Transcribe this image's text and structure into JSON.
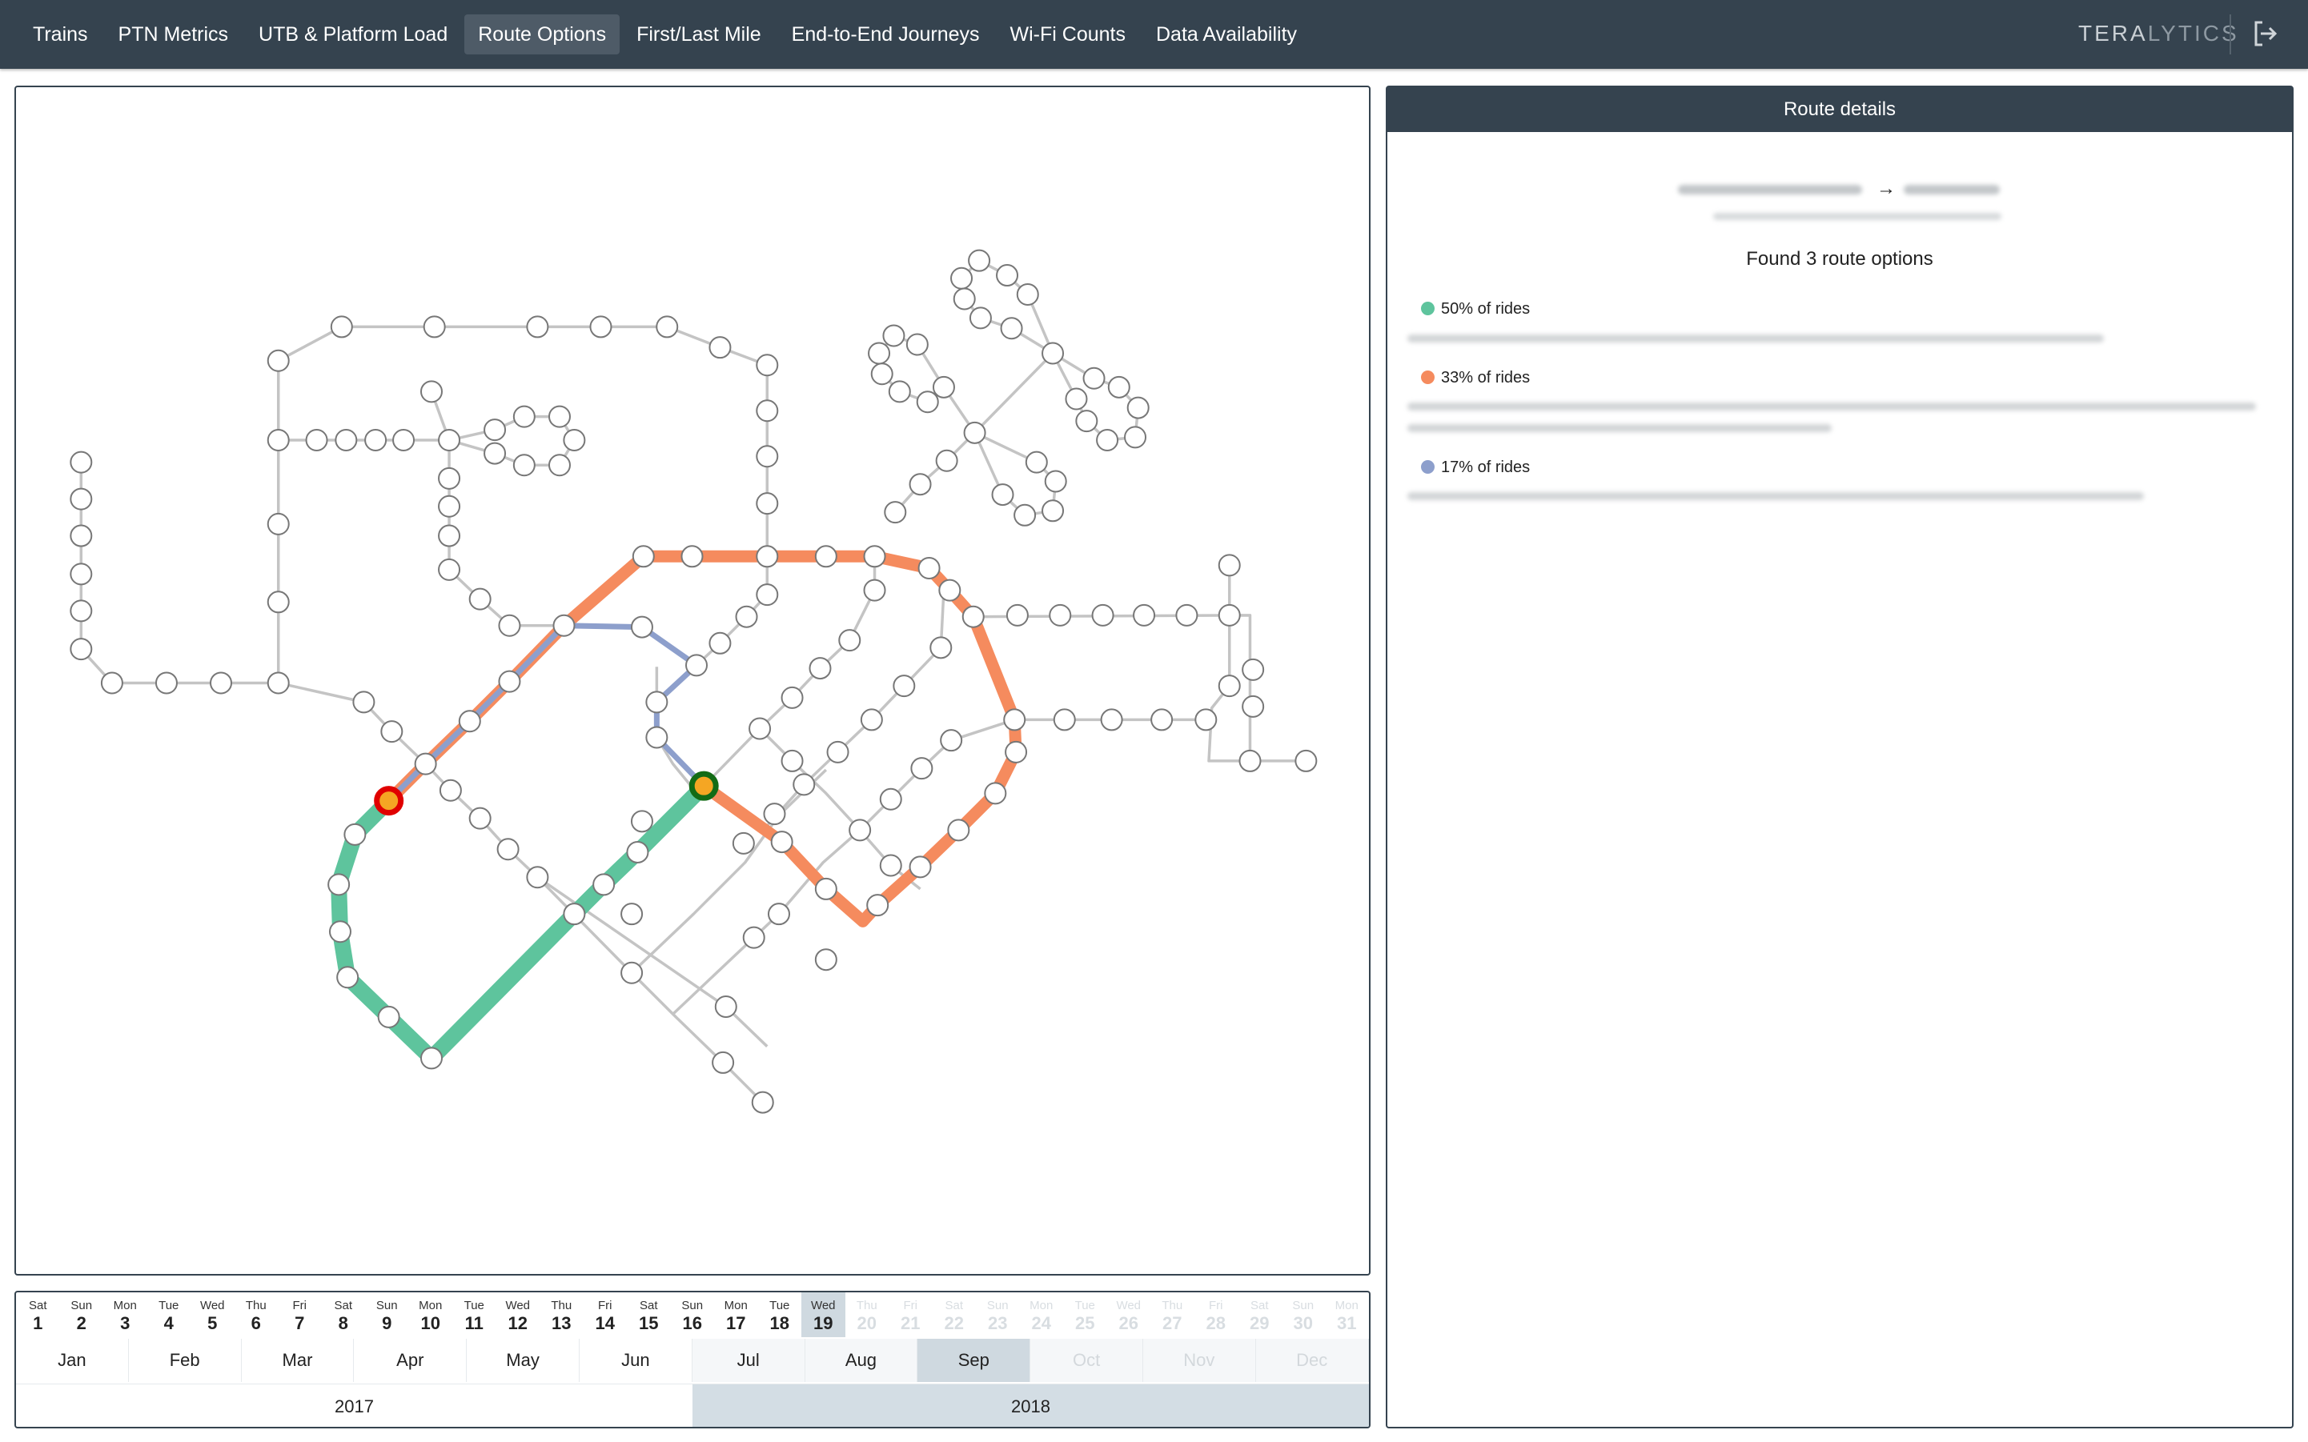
{
  "nav": {
    "tabs": [
      "Trains",
      "PTN Metrics",
      "UTB & Platform Load",
      "Route Options",
      "First/Last Mile",
      "End-to-End Journeys",
      "Wi-Fi Counts",
      "Data Availability"
    ],
    "active_tab": "Route Options",
    "brand_part1": "TERA",
    "brand_part2": "LYTICS",
    "logout_icon": "logout-icon"
  },
  "route_details": {
    "title": "Route details",
    "arrow": "→",
    "found_text": "Found 3 route options",
    "options": [
      {
        "label": "50% of rides",
        "color": "#5ec49d"
      },
      {
        "label": "33% of rides",
        "color": "#f58b5e"
      },
      {
        "label": "17% of rides",
        "color": "#8d9fcc"
      }
    ]
  },
  "map": {
    "route_colors": {
      "green": "#5ec49d",
      "orange": "#f58b5e",
      "blue": "#8d9fcc",
      "network": "#c4c4c4"
    },
    "origin_marker": "red-station-marker",
    "destination_marker": "green-station-marker"
  },
  "timeline": {
    "days": [
      {
        "dw": "Sat",
        "dn": "1"
      },
      {
        "dw": "Sun",
        "dn": "2"
      },
      {
        "dw": "Mon",
        "dn": "3"
      },
      {
        "dw": "Tue",
        "dn": "4"
      },
      {
        "dw": "Wed",
        "dn": "5"
      },
      {
        "dw": "Thu",
        "dn": "6"
      },
      {
        "dw": "Fri",
        "dn": "7"
      },
      {
        "dw": "Sat",
        "dn": "8"
      },
      {
        "dw": "Sun",
        "dn": "9"
      },
      {
        "dw": "Mon",
        "dn": "10"
      },
      {
        "dw": "Tue",
        "dn": "11"
      },
      {
        "dw": "Wed",
        "dn": "12"
      },
      {
        "dw": "Thu",
        "dn": "13"
      },
      {
        "dw": "Fri",
        "dn": "14"
      },
      {
        "dw": "Sat",
        "dn": "15"
      },
      {
        "dw": "Sun",
        "dn": "16"
      },
      {
        "dw": "Mon",
        "dn": "17"
      },
      {
        "dw": "Tue",
        "dn": "18"
      },
      {
        "dw": "Wed",
        "dn": "19"
      },
      {
        "dw": "Thu",
        "dn": "20"
      },
      {
        "dw": "Fri",
        "dn": "21"
      },
      {
        "dw": "Sat",
        "dn": "22"
      },
      {
        "dw": "Sun",
        "dn": "23"
      },
      {
        "dw": "Mon",
        "dn": "24"
      },
      {
        "dw": "Tue",
        "dn": "25"
      },
      {
        "dw": "Wed",
        "dn": "26"
      },
      {
        "dw": "Thu",
        "dn": "27"
      },
      {
        "dw": "Fri",
        "dn": "28"
      },
      {
        "dw": "Sat",
        "dn": "29"
      },
      {
        "dw": "Sun",
        "dn": "30"
      },
      {
        "dw": "Mon",
        "dn": "31"
      }
    ],
    "selected_day": "19",
    "months": [
      "Jan",
      "Feb",
      "Mar",
      "Apr",
      "May",
      "Jun",
      "Jul",
      "Aug",
      "Sep",
      "Oct",
      "Nov",
      "Dec"
    ],
    "selected_month": "Sep",
    "years": [
      "2017",
      "2018"
    ],
    "selected_year": "2018"
  }
}
